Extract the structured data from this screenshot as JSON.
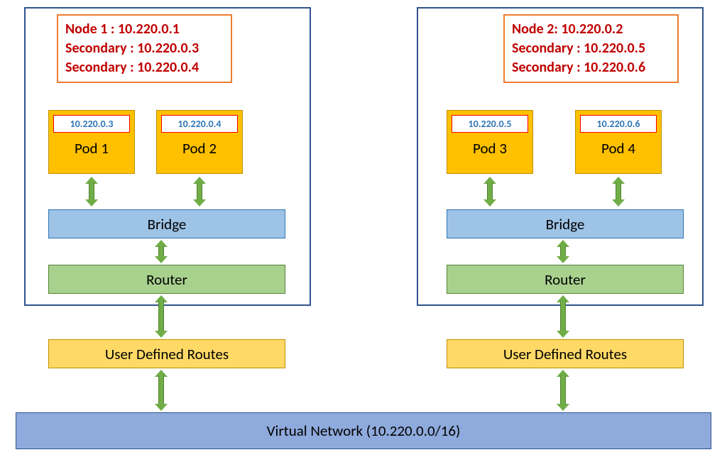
{
  "labels": {
    "bridge": "Bridge",
    "router": "Router",
    "udr": "User Defined Routes",
    "vnet": "Virtual Network (10.220.0.0/16)"
  },
  "node1": {
    "title": "Node 1 : 10.220.0.1",
    "secondary1": "Secondary : 10.220.0.3",
    "secondary2": "Secondary : 10.220.0.4",
    "pod1": {
      "label": "Pod 1",
      "ip": "10.220.0.3"
    },
    "pod2": {
      "label": "Pod 2",
      "ip": "10.220.0.4"
    }
  },
  "node2": {
    "title": "Node 2: 10.220.0.2",
    "secondary1": "Secondary : 10.220.0.5",
    "secondary2": "Secondary : 10.220.0.6",
    "pod3": {
      "label": "Pod 3",
      "ip": "10.220.0.5"
    },
    "pod4": {
      "label": "Pod 4",
      "ip": "10.220.0.6"
    }
  }
}
